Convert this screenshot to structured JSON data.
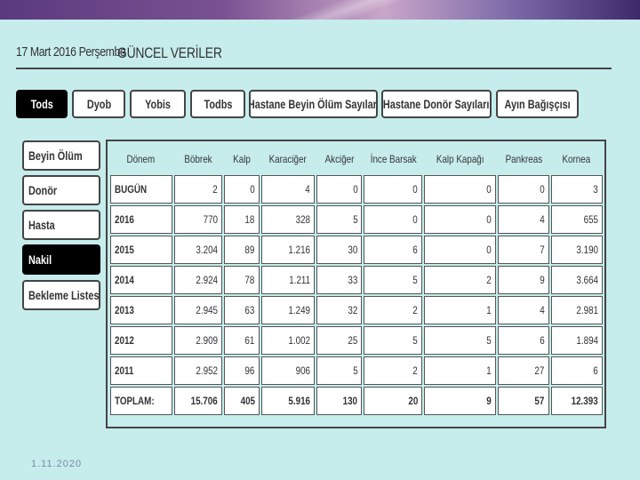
{
  "header": {
    "date": "17 Mart 2016 Perşembe",
    "title": "GÜNCEL VERİLER"
  },
  "tabs": [
    {
      "label": "Tods",
      "active": true
    },
    {
      "label": "Dyob",
      "active": false
    },
    {
      "label": "Yobis",
      "active": false
    },
    {
      "label": "Todbs",
      "active": false
    },
    {
      "label": "Hastane Beyin Ölüm Sayıları",
      "active": false
    },
    {
      "label": "Hastane Donör Sayıları",
      "active": false
    },
    {
      "label": "Ayın Bağışçısı",
      "active": false
    }
  ],
  "sidebar": {
    "items": [
      {
        "label": "Beyin Ölüm",
        "active": false
      },
      {
        "label": "Donör",
        "active": false
      },
      {
        "label": "Hasta",
        "active": false
      },
      {
        "label": "Nakil",
        "active": true
      },
      {
        "label": "Bekleme Listesi",
        "active": false
      }
    ]
  },
  "table": {
    "columns": [
      "Dönem",
      "Böbrek",
      "Kalp",
      "Karaciğer",
      "Akciğer",
      "İnce Barsak",
      "Kalp Kapağı",
      "Pankreas",
      "Kornea"
    ],
    "rows": [
      [
        "BUGÜN",
        "2",
        "0",
        "4",
        "0",
        "0",
        "0",
        "0",
        "3"
      ],
      [
        "2016",
        "770",
        "18",
        "328",
        "5",
        "0",
        "0",
        "4",
        "655"
      ],
      [
        "2015",
        "3.204",
        "89",
        "1.216",
        "30",
        "6",
        "0",
        "7",
        "3.190"
      ],
      [
        "2014",
        "2.924",
        "78",
        "1.211",
        "33",
        "5",
        "2",
        "9",
        "3.664"
      ],
      [
        "2013",
        "2.945",
        "63",
        "1.249",
        "32",
        "2",
        "1",
        "4",
        "2.981"
      ],
      [
        "2012",
        "2.909",
        "61",
        "1.002",
        "25",
        "5",
        "5",
        "6",
        "1.894"
      ],
      [
        "2011",
        "2.952",
        "96",
        "906",
        "5",
        "2",
        "1",
        "27",
        "6"
      ],
      [
        "TOPLAM:",
        "15.706",
        "405",
        "5.916",
        "130",
        "20",
        "9",
        "57",
        "12.393"
      ]
    ]
  },
  "footer": {
    "date": "1.11.2020"
  }
}
